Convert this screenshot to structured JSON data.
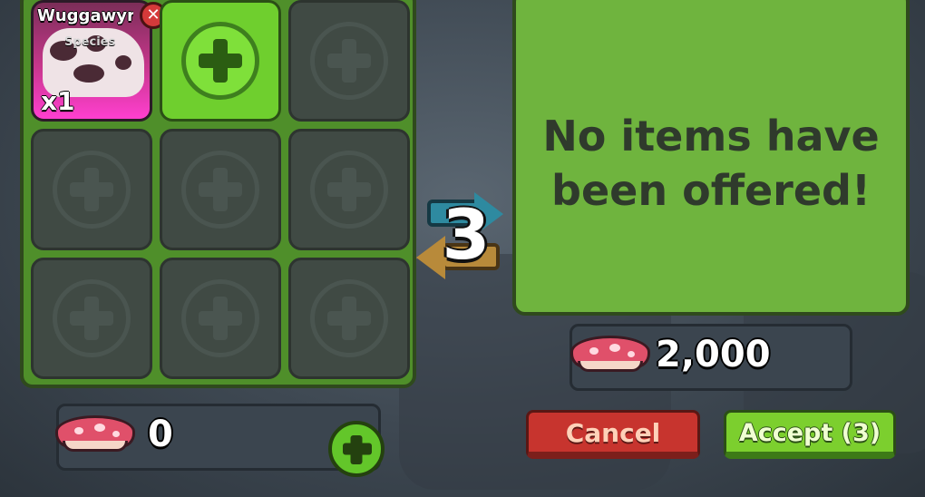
{
  "offer": {
    "slots": [
      {
        "type": "item",
        "name": "Wuggawyrm",
        "subtitle": "Species",
        "quantity": "x1"
      },
      {
        "type": "add"
      },
      {
        "type": "empty"
      },
      {
        "type": "empty"
      },
      {
        "type": "empty"
      },
      {
        "type": "empty"
      },
      {
        "type": "empty"
      },
      {
        "type": "empty"
      },
      {
        "type": "empty"
      }
    ],
    "currency_amount": "0"
  },
  "exchange": {
    "count": "3"
  },
  "partner": {
    "empty_message": "No items have\nbeen offered!",
    "currency_amount": "2,000"
  },
  "buttons": {
    "cancel": "Cancel",
    "accept": "Accept (3)"
  },
  "colors": {
    "panel_green": "#4f8f2a",
    "slot_empty": "#404a44",
    "add_slot": "#6fcf2e",
    "cancel_red": "#c7342e",
    "accept_green": "#7ccf2e",
    "currency_icon": "mushroom-icon"
  }
}
